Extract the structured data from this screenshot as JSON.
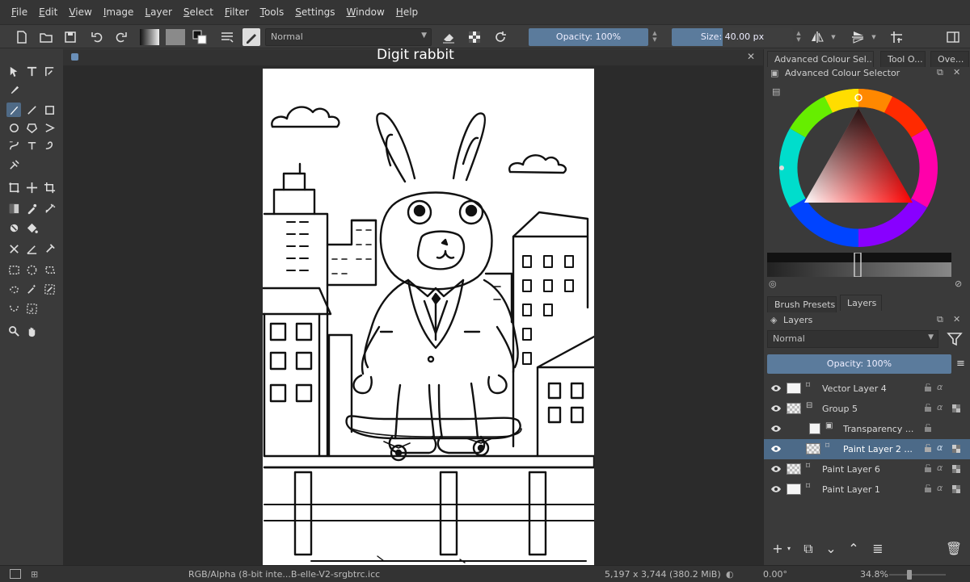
{
  "menubar": {
    "items": [
      "File",
      "Edit",
      "View",
      "Image",
      "Layer",
      "Select",
      "Filter",
      "Tools",
      "Settings",
      "Window",
      "Help"
    ]
  },
  "toolbar": {
    "blend_mode": "Normal",
    "opacity_label": "Opacity: 100%",
    "size_label": "Size: 40.00 px"
  },
  "document": {
    "title": "Digit rabbit",
    "close_glyph": "✕"
  },
  "right_panel": {
    "tabs": [
      "Advanced Colour Sel...",
      "Tool O...",
      "Ove..."
    ],
    "color_selector_title": "Advanced Colour Selector",
    "lower_tabs": [
      "Brush Presets",
      "Layers"
    ],
    "layers_title": "Layers",
    "layer_blend_mode": "Normal",
    "layer_opacity_label": "Opacity:  100%",
    "layers": [
      {
        "name": "Vector Layer 4",
        "type_icon": "vector-icon"
      },
      {
        "name": "Group 5",
        "type_icon": "group-icon"
      },
      {
        "name": "Transparency ...",
        "type_icon": "mask-icon"
      },
      {
        "name": "Paint Layer 2 ...",
        "type_icon": "paint-icon",
        "selected": true
      },
      {
        "name": "Paint Layer 6",
        "type_icon": "paint-icon"
      },
      {
        "name": "Paint Layer 1",
        "type_icon": "paint-icon"
      }
    ]
  },
  "statusbar": {
    "color_profile": "RGB/Alpha (8-bit inte...B-elle-V2-srgbtrc.icc",
    "dimensions": "5,197 x 3,744 (380.2 MiB)",
    "rotation": "0.00°",
    "zoom": "34.8%"
  },
  "colors": {
    "accent": "#5b7b9c",
    "selected_layer": "#4c6a88",
    "background": "#3a3a3a",
    "canvas_bg": "#2b2b2b"
  }
}
